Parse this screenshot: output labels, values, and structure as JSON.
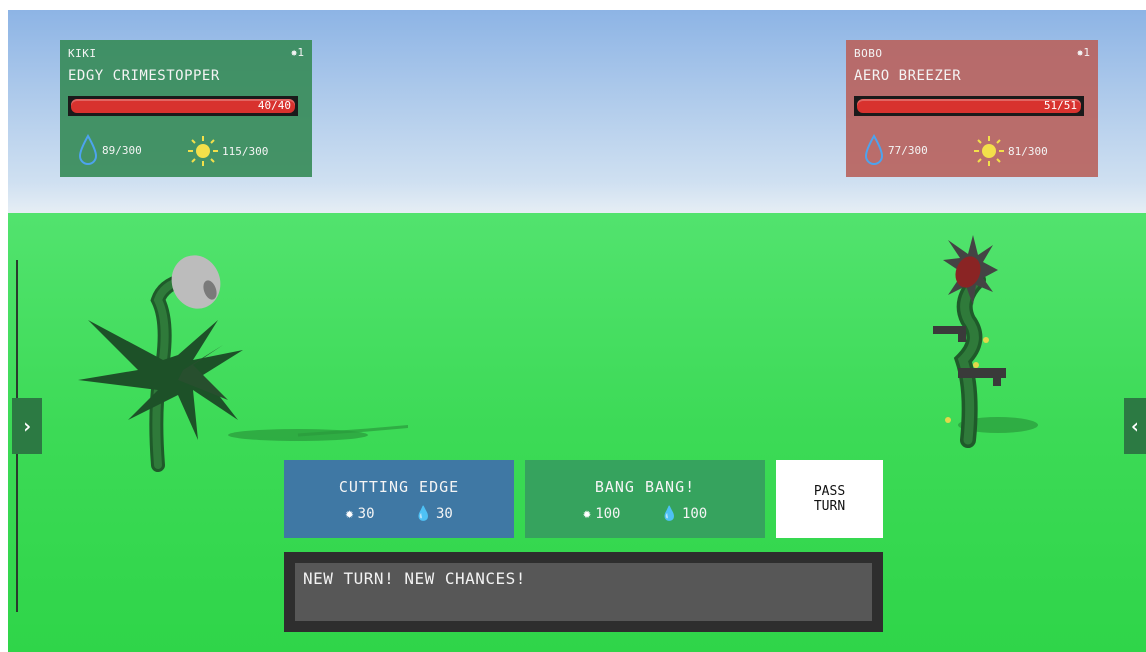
{
  "player": {
    "name": "KIKI",
    "level": "1",
    "plant_name": "EDGY CRIMESTOPPER",
    "hp": "40/40",
    "hp_fraction": 1.0,
    "water": "89/300",
    "sun": "115/300"
  },
  "enemy": {
    "name": "BOBO",
    "level": "1",
    "plant_name": "AERO BREEZER",
    "hp": "51/51",
    "hp_fraction": 1.0,
    "water": "77/300",
    "sun": "81/300"
  },
  "actions": [
    {
      "label": "CUTTING EDGE",
      "sun_cost": "30",
      "water_cost": "30"
    },
    {
      "label": "BANG BANG!",
      "sun_cost": "100",
      "water_cost": "100"
    }
  ],
  "pass": {
    "line1": "PASS",
    "line2": "TURN"
  },
  "log": {
    "message": "NEW TURN! NEW CHANCES!"
  },
  "nav": {
    "left_icon": "chevron-right-icon",
    "right_icon": "chevron-left-icon"
  },
  "colors": {
    "player_card": "#388c5a",
    "enemy_card": "#b9645f",
    "hp_bar": "#d8322e",
    "cutting_edge": "#3f78a4",
    "bang_bang": "#36a35e",
    "water_icon": "#4da3ee",
    "sun_icon": "#f3e04a"
  }
}
